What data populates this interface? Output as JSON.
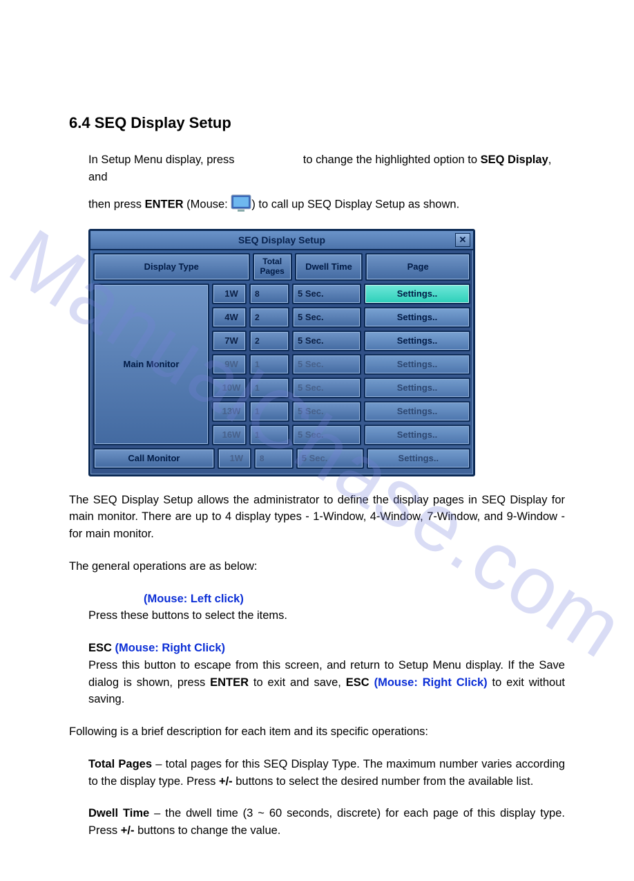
{
  "watermark": "ManualChase.com",
  "section": {
    "number": "6.4",
    "title": "SEQ Display Setup"
  },
  "intro": {
    "line1_a": "In Setup Menu display, press",
    "line1_b": "to change the highlighted option to ",
    "seq_display": "SEQ Display",
    "line1_c": ", and",
    "line2_a": "then press ",
    "enter": "ENTER",
    "line2_b": " (Mouse: ",
    "line2_c": ") to call up SEQ Display Setup as shown."
  },
  "osd": {
    "title": "SEQ Display Setup",
    "close_glyph": "✕",
    "headers": {
      "display_type": "Display Type",
      "total_pages_top": "Total",
      "total_pages_bot": "Pages",
      "dwell_time": "Dwell Time",
      "page": "Page"
    },
    "main_monitor_label": "Main Monitor",
    "call_monitor_label": "Call Monitor",
    "settings_label": "Settings..",
    "rows": [
      {
        "wtype": "1W",
        "pages": "8",
        "dwell": "5 Sec.",
        "selected": true,
        "dim": false
      },
      {
        "wtype": "4W",
        "pages": "2",
        "dwell": "5 Sec.",
        "selected": false,
        "dim": false
      },
      {
        "wtype": "7W",
        "pages": "2",
        "dwell": "5 Sec.",
        "selected": false,
        "dim": false
      },
      {
        "wtype": "9W",
        "pages": "1",
        "dwell": "5 Sec.",
        "selected": false,
        "dim": true
      },
      {
        "wtype": "10W",
        "pages": "1",
        "dwell": "5 Sec.",
        "selected": false,
        "dim": true
      },
      {
        "wtype": "13W",
        "pages": "1",
        "dwell": "5 Sec.",
        "selected": false,
        "dim": true
      },
      {
        "wtype": "16W",
        "pages": "1",
        "dwell": "5 Sec.",
        "selected": false,
        "dim": true
      }
    ],
    "call_row": {
      "wtype": "1W",
      "pages": "8",
      "dwell": "5 Sec.",
      "dim": true
    }
  },
  "desc1": "The SEQ Display Setup allows the administrator to define the display pages in SEQ Display for main monitor.  There are up to 4 display types - 1-Window, 4-Window, 7-Window, and 9-Window - for main monitor.",
  "desc2": "The general operations are as below:",
  "ops": {
    "mouse_left": "(Mouse: Left click)",
    "mouse_left_body": "Press these buttons to select the items.",
    "esc_label": "ESC",
    "mouse_right": " (Mouse: Right Click)",
    "esc_body_a": "Press this button to escape from this screen, and return to Setup Menu display.   If the Save dialog is shown, press ",
    "enter2": "ENTER",
    "esc_body_b": " to exit and save, ",
    "esc2": "ESC",
    "mouse_right2": " (Mouse: Right Click)",
    "esc_body_c": " to exit without saving."
  },
  "following": "Following is a brief description for each item and its specific operations:",
  "items": {
    "total_pages_label": "Total Pages",
    "total_pages_body_a": " – total pages for this SEQ Display Type.    The maximum number varies according to the display type.    Press ",
    "plusminus": "+/-",
    "total_pages_body_b": " buttons to select the desired number from the available list.",
    "dwell_label": "Dwell Time",
    "dwell_body_a": " – the dwell time (3 ~ 60 seconds, discrete) for each page of this display type. Press ",
    "dwell_body_b": " buttons to change the value."
  }
}
